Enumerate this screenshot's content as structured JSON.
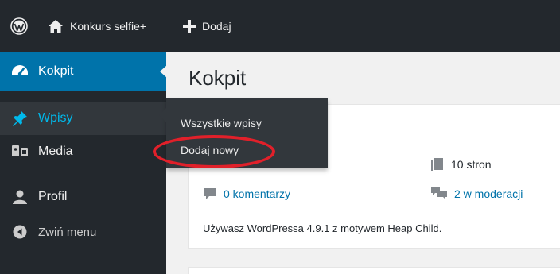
{
  "admin_bar": {
    "logo_icon": "wordpress-logo-icon",
    "site_name": "Konkurs selfie+",
    "site_icon": "home-icon",
    "new_label": "Dodaj",
    "new_icon": "plus-icon"
  },
  "sidebar": {
    "items": [
      {
        "label": "Kokpit",
        "icon": "dashboard-gauge-icon",
        "state": "current"
      },
      {
        "label": "Wpisy",
        "icon": "pushpin-icon",
        "state": "hover"
      },
      {
        "label": "Media",
        "icon": "media-icon"
      },
      {
        "label": "Profil",
        "icon": "user-icon"
      },
      {
        "label": "Zwiń menu",
        "icon": "collapse-arrow-icon"
      }
    ]
  },
  "flyout": {
    "items": [
      {
        "label": "Wszystkie wpisy"
      },
      {
        "label": "Dodaj nowy",
        "highlighted": true
      }
    ]
  },
  "main": {
    "title": "Kokpit",
    "at_a_glance": {
      "posts": "",
      "pages": "10 stron",
      "comments": "0 komentarzy",
      "moderation": "2 w moderacji",
      "footer": "Używasz WordPressa 4.9.1 z motywem Heap Child."
    }
  },
  "colors": {
    "admin_bar_bg": "#23282d",
    "menu_current_bg": "#0073aa",
    "submenu_bg": "#32373c",
    "link": "#0073aa",
    "annotation_ellipse": "#e1202a"
  }
}
